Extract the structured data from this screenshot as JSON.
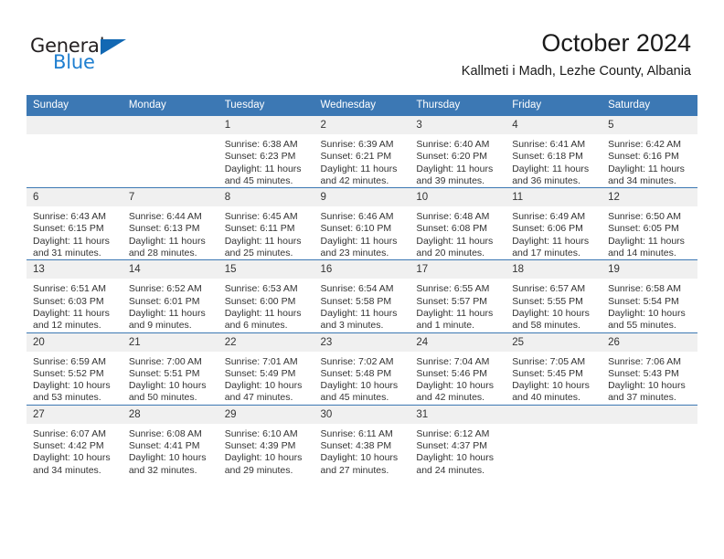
{
  "brand": {
    "name_part1": "General",
    "name_part2": "Blue"
  },
  "header": {
    "month_title": "October 2024",
    "location": "Kallmeti i Madh, Lezhe County, Albania"
  },
  "colors": {
    "header_blue": "#3c78b4",
    "logo_blue": "#1f7fd0",
    "daynum_background": "#f0f0f0",
    "text": "#333333"
  },
  "weekdays": [
    "Sunday",
    "Monday",
    "Tuesday",
    "Wednesday",
    "Thursday",
    "Friday",
    "Saturday"
  ],
  "weeks": [
    [
      {
        "day": "",
        "sunrise": "",
        "sunset": "",
        "daylight": "",
        "empty": true
      },
      {
        "day": "",
        "sunrise": "",
        "sunset": "",
        "daylight": "",
        "empty": true
      },
      {
        "day": "1",
        "sunrise": "Sunrise: 6:38 AM",
        "sunset": "Sunset: 6:23 PM",
        "daylight": "Daylight: 11 hours and 45 minutes."
      },
      {
        "day": "2",
        "sunrise": "Sunrise: 6:39 AM",
        "sunset": "Sunset: 6:21 PM",
        "daylight": "Daylight: 11 hours and 42 minutes."
      },
      {
        "day": "3",
        "sunrise": "Sunrise: 6:40 AM",
        "sunset": "Sunset: 6:20 PM",
        "daylight": "Daylight: 11 hours and 39 minutes."
      },
      {
        "day": "4",
        "sunrise": "Sunrise: 6:41 AM",
        "sunset": "Sunset: 6:18 PM",
        "daylight": "Daylight: 11 hours and 36 minutes."
      },
      {
        "day": "5",
        "sunrise": "Sunrise: 6:42 AM",
        "sunset": "Sunset: 6:16 PM",
        "daylight": "Daylight: 11 hours and 34 minutes."
      }
    ],
    [
      {
        "day": "6",
        "sunrise": "Sunrise: 6:43 AM",
        "sunset": "Sunset: 6:15 PM",
        "daylight": "Daylight: 11 hours and 31 minutes."
      },
      {
        "day": "7",
        "sunrise": "Sunrise: 6:44 AM",
        "sunset": "Sunset: 6:13 PM",
        "daylight": "Daylight: 11 hours and 28 minutes."
      },
      {
        "day": "8",
        "sunrise": "Sunrise: 6:45 AM",
        "sunset": "Sunset: 6:11 PM",
        "daylight": "Daylight: 11 hours and 25 minutes."
      },
      {
        "day": "9",
        "sunrise": "Sunrise: 6:46 AM",
        "sunset": "Sunset: 6:10 PM",
        "daylight": "Daylight: 11 hours and 23 minutes."
      },
      {
        "day": "10",
        "sunrise": "Sunrise: 6:48 AM",
        "sunset": "Sunset: 6:08 PM",
        "daylight": "Daylight: 11 hours and 20 minutes."
      },
      {
        "day": "11",
        "sunrise": "Sunrise: 6:49 AM",
        "sunset": "Sunset: 6:06 PM",
        "daylight": "Daylight: 11 hours and 17 minutes."
      },
      {
        "day": "12",
        "sunrise": "Sunrise: 6:50 AM",
        "sunset": "Sunset: 6:05 PM",
        "daylight": "Daylight: 11 hours and 14 minutes."
      }
    ],
    [
      {
        "day": "13",
        "sunrise": "Sunrise: 6:51 AM",
        "sunset": "Sunset: 6:03 PM",
        "daylight": "Daylight: 11 hours and 12 minutes."
      },
      {
        "day": "14",
        "sunrise": "Sunrise: 6:52 AM",
        "sunset": "Sunset: 6:01 PM",
        "daylight": "Daylight: 11 hours and 9 minutes."
      },
      {
        "day": "15",
        "sunrise": "Sunrise: 6:53 AM",
        "sunset": "Sunset: 6:00 PM",
        "daylight": "Daylight: 11 hours and 6 minutes."
      },
      {
        "day": "16",
        "sunrise": "Sunrise: 6:54 AM",
        "sunset": "Sunset: 5:58 PM",
        "daylight": "Daylight: 11 hours and 3 minutes."
      },
      {
        "day": "17",
        "sunrise": "Sunrise: 6:55 AM",
        "sunset": "Sunset: 5:57 PM",
        "daylight": "Daylight: 11 hours and 1 minute."
      },
      {
        "day": "18",
        "sunrise": "Sunrise: 6:57 AM",
        "sunset": "Sunset: 5:55 PM",
        "daylight": "Daylight: 10 hours and 58 minutes."
      },
      {
        "day": "19",
        "sunrise": "Sunrise: 6:58 AM",
        "sunset": "Sunset: 5:54 PM",
        "daylight": "Daylight: 10 hours and 55 minutes."
      }
    ],
    [
      {
        "day": "20",
        "sunrise": "Sunrise: 6:59 AM",
        "sunset": "Sunset: 5:52 PM",
        "daylight": "Daylight: 10 hours and 53 minutes."
      },
      {
        "day": "21",
        "sunrise": "Sunrise: 7:00 AM",
        "sunset": "Sunset: 5:51 PM",
        "daylight": "Daylight: 10 hours and 50 minutes."
      },
      {
        "day": "22",
        "sunrise": "Sunrise: 7:01 AM",
        "sunset": "Sunset: 5:49 PM",
        "daylight": "Daylight: 10 hours and 47 minutes."
      },
      {
        "day": "23",
        "sunrise": "Sunrise: 7:02 AM",
        "sunset": "Sunset: 5:48 PM",
        "daylight": "Daylight: 10 hours and 45 minutes."
      },
      {
        "day": "24",
        "sunrise": "Sunrise: 7:04 AM",
        "sunset": "Sunset: 5:46 PM",
        "daylight": "Daylight: 10 hours and 42 minutes."
      },
      {
        "day": "25",
        "sunrise": "Sunrise: 7:05 AM",
        "sunset": "Sunset: 5:45 PM",
        "daylight": "Daylight: 10 hours and 40 minutes."
      },
      {
        "day": "26",
        "sunrise": "Sunrise: 7:06 AM",
        "sunset": "Sunset: 5:43 PM",
        "daylight": "Daylight: 10 hours and 37 minutes."
      }
    ],
    [
      {
        "day": "27",
        "sunrise": "Sunrise: 6:07 AM",
        "sunset": "Sunset: 4:42 PM",
        "daylight": "Daylight: 10 hours and 34 minutes."
      },
      {
        "day": "28",
        "sunrise": "Sunrise: 6:08 AM",
        "sunset": "Sunset: 4:41 PM",
        "daylight": "Daylight: 10 hours and 32 minutes."
      },
      {
        "day": "29",
        "sunrise": "Sunrise: 6:10 AM",
        "sunset": "Sunset: 4:39 PM",
        "daylight": "Daylight: 10 hours and 29 minutes."
      },
      {
        "day": "30",
        "sunrise": "Sunrise: 6:11 AM",
        "sunset": "Sunset: 4:38 PM",
        "daylight": "Daylight: 10 hours and 27 minutes."
      },
      {
        "day": "31",
        "sunrise": "Sunrise: 6:12 AM",
        "sunset": "Sunset: 4:37 PM",
        "daylight": "Daylight: 10 hours and 24 minutes."
      },
      {
        "day": "",
        "sunrise": "",
        "sunset": "",
        "daylight": "",
        "empty": true
      },
      {
        "day": "",
        "sunrise": "",
        "sunset": "",
        "daylight": "",
        "empty": true
      }
    ]
  ]
}
